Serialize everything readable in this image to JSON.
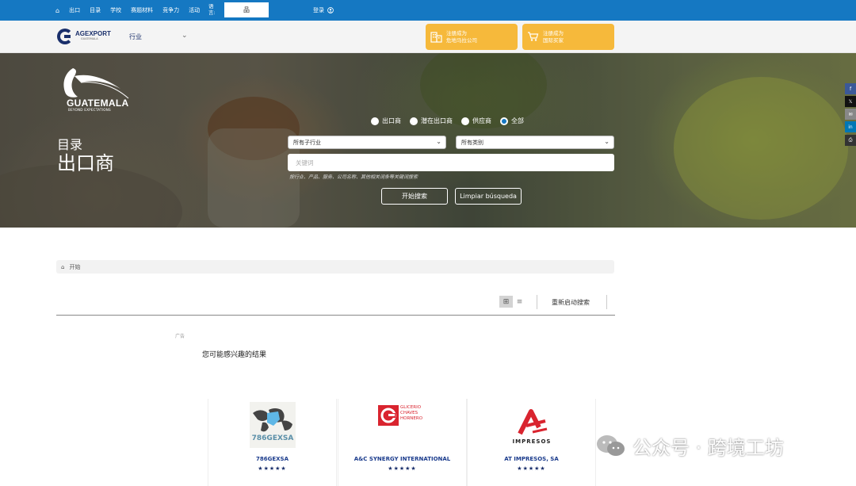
{
  "topbar": {
    "nav": [
      "出口",
      "目录",
      "学校",
      "赛题材料",
      "竞争力",
      "活动"
    ],
    "lang_label": "语言:",
    "lang_value": "品",
    "login": "登录"
  },
  "header": {
    "brand": "AGEXPORT",
    "brand_sub": "GUATEMALA",
    "industry": "行业",
    "register_exporter": [
      "注册成为",
      "危地马拉公司"
    ],
    "register_buyer": [
      "注册成为",
      "国际买家"
    ]
  },
  "hero": {
    "gt_name": "GUATEMALA",
    "gt_tagline": "BEYOND EXPECTATIONS",
    "title_small": "目录",
    "title_big": "出口商",
    "radios": [
      {
        "label": "出口商",
        "selected": false
      },
      {
        "label": "潜在出口商",
        "selected": false
      },
      {
        "label": "供应商",
        "selected": false
      },
      {
        "label": "全部",
        "selected": true
      }
    ],
    "subsector": "所有子行业",
    "category": "所有类别",
    "keyword_placeholder": "关键词",
    "hint": "按行业、产品、服务、公司名称、其他相关词条等关键词搜索",
    "search_button": "开始搜索",
    "clear_button": "Limpiar búsqueda"
  },
  "share": [
    "f",
    "𝕏",
    "✉",
    "in",
    "⎙"
  ],
  "breadcrumb": "开始",
  "restart": "重新启动搜索",
  "ad_label": "广告",
  "interest": "您可能感兴趣的结果",
  "cards": [
    {
      "name": "786GEXSA",
      "logo_text": "786GEXSA",
      "stars": "★★★★★"
    },
    {
      "name": "A&C SYNERGY INTERNATIONAL",
      "logo_text": "GLICERIO CHAVES HORNERO",
      "stars": "★★★★★"
    },
    {
      "name": "AT IMPRESOS, SA",
      "logo_text": "IMPRESOS",
      "stars": "★★★★★"
    }
  ],
  "watermark": "公众号 · 跨境工坊",
  "colors": {
    "topbar": "#1578c2",
    "accent_orange": "#f6b93b",
    "brand_navy": "#1a2f6b"
  }
}
